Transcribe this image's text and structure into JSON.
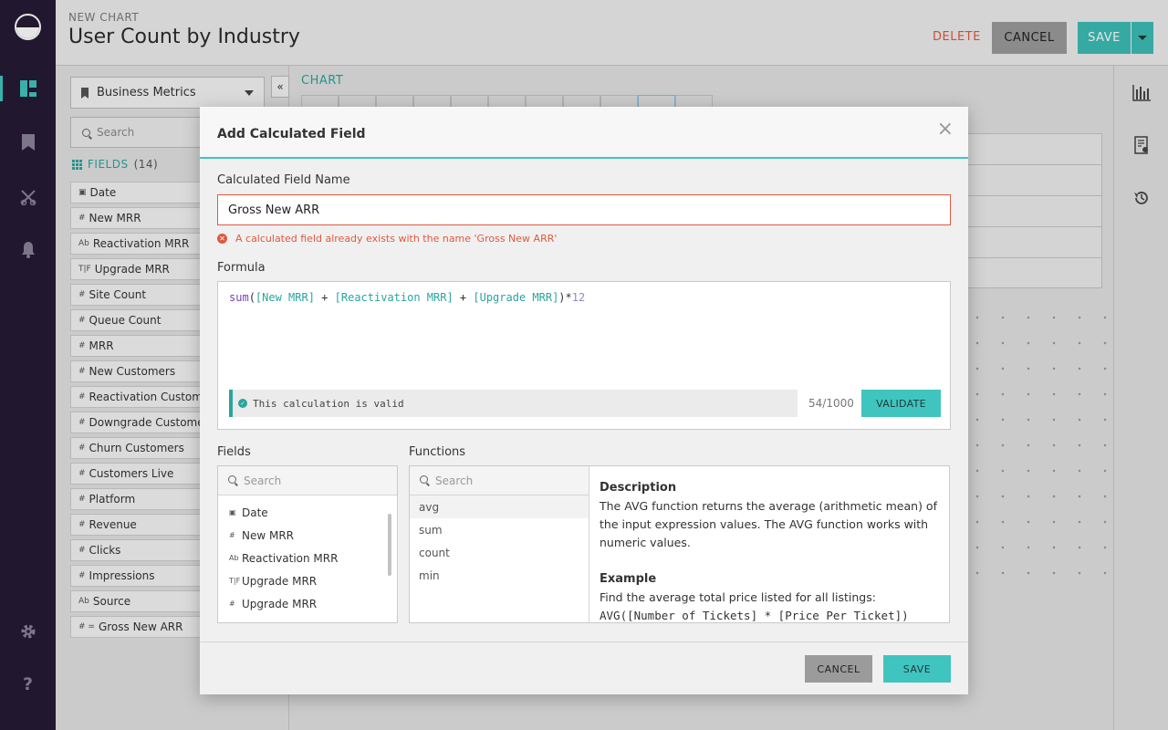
{
  "nav": {
    "items": [
      {
        "name": "dashboard-icon",
        "glyph": ""
      },
      {
        "name": "bookmark-icon",
        "glyph": "▮"
      },
      {
        "name": "scissors-icon",
        "glyph": "✂"
      },
      {
        "name": "bell-icon",
        "glyph": "🔔"
      },
      {
        "name": "gear-icon",
        "glyph": "⚙"
      },
      {
        "name": "help-icon",
        "glyph": "?"
      }
    ]
  },
  "header": {
    "subtitle": "NEW CHART",
    "title": "User Count by Industry",
    "delete_label": "DELETE",
    "cancel_label": "CANCEL",
    "save_label": "SAVE"
  },
  "left_panel": {
    "datasource": "Business Metrics",
    "collapse_glyph": "«",
    "search_placeholder": "Search",
    "fields_label": "FIELDS",
    "fields_count": "(14)",
    "fields": [
      {
        "type": "▣",
        "label": "Date"
      },
      {
        "type": "#",
        "label": "New MRR"
      },
      {
        "type": "Ab",
        "label": "Reactivation MRR"
      },
      {
        "type": "T|F",
        "label": "Upgrade MRR"
      },
      {
        "type": "#",
        "label": "Site Count"
      },
      {
        "type": "#",
        "label": "Queue Count"
      },
      {
        "type": "#",
        "label": "MRR"
      },
      {
        "type": "#",
        "label": "New Customers"
      },
      {
        "type": "#",
        "label": "Reactivation Customers"
      },
      {
        "type": "#",
        "label": "Downgrade Customers"
      },
      {
        "type": "#",
        "label": "Churn Customers"
      },
      {
        "type": "#",
        "label": "Customers Live"
      },
      {
        "type": "#",
        "label": "Platform"
      },
      {
        "type": "#",
        "label": "Revenue"
      },
      {
        "type": "#",
        "label": "Clicks"
      },
      {
        "type": "#",
        "label": "Impressions"
      },
      {
        "type": "Ab",
        "label": "Source"
      },
      {
        "type": "# =",
        "label": "Gross New ARR"
      }
    ]
  },
  "chart_area": {
    "label": "CHART"
  },
  "modal": {
    "title": "Add Calculated Field",
    "close_glyph": "×",
    "name_label": "Calculated Field Name",
    "name_value": "Gross New ARR",
    "error_text": "A calculated field already exists with the name 'Gross New ARR'",
    "formula_label": "Formula",
    "formula": {
      "fn": "sum",
      "open": "(",
      "field1": "[New MRR]",
      "op1": " + ",
      "field2": "[Reactivation MRR]",
      "op2": " + ",
      "field3": "[Upgrade MRR]",
      "close": ")*",
      "num": "12"
    },
    "valid_text": "This calculation is valid",
    "char_count": "54/1000",
    "validate_label": "VALIDATE",
    "fields_label": "Fields",
    "fields_search_placeholder": "Search",
    "fields_list": [
      {
        "type": "▣",
        "label": "Date"
      },
      {
        "type": "#",
        "label": "New MRR"
      },
      {
        "type": "Ab",
        "label": "Reactivation MRR"
      },
      {
        "type": "T|F",
        "label": "Upgrade MRR"
      },
      {
        "type": "#",
        "label": "Upgrade MRR"
      }
    ],
    "functions_label": "Functions",
    "functions_search_placeholder": "Search",
    "functions": [
      "avg",
      "sum",
      "count",
      "min"
    ],
    "description_heading": "Description",
    "description_text": "The AVG function returns the average (arithmetic mean) of the input expression values. The AVG function works with numeric values.",
    "example_heading": "Example",
    "example_text": "Find the average total price listed for all listings:",
    "example_code": "AVG([Number of Tickets] * [Price Per Ticket])",
    "cancel_label": "CANCEL",
    "save_label": "SAVE"
  },
  "colors": {
    "accent": "#40c4bf",
    "error": "#e0593f",
    "nav_bg": "#251b35"
  }
}
